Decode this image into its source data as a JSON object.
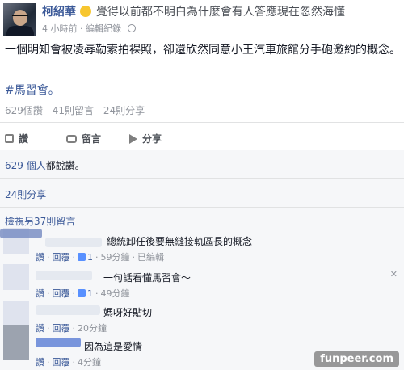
{
  "post": {
    "author": "柯紹華",
    "feeling": "覺得以前都不明白為什麼會有人答應現在忽然海懂",
    "time": "4 小時前",
    "edit_history": "編輯紀錄",
    "body": "一個明知會被凌辱勒索拍裸照，卻還欣然同意小王汽車旅館分手砲邀約的概念。",
    "hashtag": "#馬習會。",
    "stats": {
      "likes": "629個讚",
      "comments": "41則留言",
      "shares": "24則分享"
    }
  },
  "actions": {
    "like": "讚",
    "comment": "留言",
    "share": "分享"
  },
  "feedback": {
    "likes_summary_count": "629 個人",
    "likes_summary_suffix": "都說讚。",
    "shares_summary": "24則分享",
    "view_more": "檢視另37則留言"
  },
  "comment_actions": {
    "like": "讚",
    "reply": "回覆",
    "edited": "已編輯"
  },
  "comments": [
    {
      "text": "總統卸任後要無縫接軌區長的概念",
      "likes": "1",
      "time": "59分鐘"
    },
    {
      "text": "一句話看懂馬習會～",
      "likes": "1",
      "time": "49分鐘"
    },
    {
      "text": "媽呀好貼切",
      "time": "20分鐘"
    },
    {
      "text": "因為這是愛情",
      "time": "4分鐘"
    }
  ],
  "watermark": "funpeer.com",
  "icons": [
    "globe-icon",
    "like-icon",
    "comment-icon",
    "share-icon",
    "thumb-icon",
    "close-icon"
  ],
  "colors": {
    "link": "#3b5998",
    "muted": "#90949c",
    "feedback_bg": "#f6f7f9"
  }
}
